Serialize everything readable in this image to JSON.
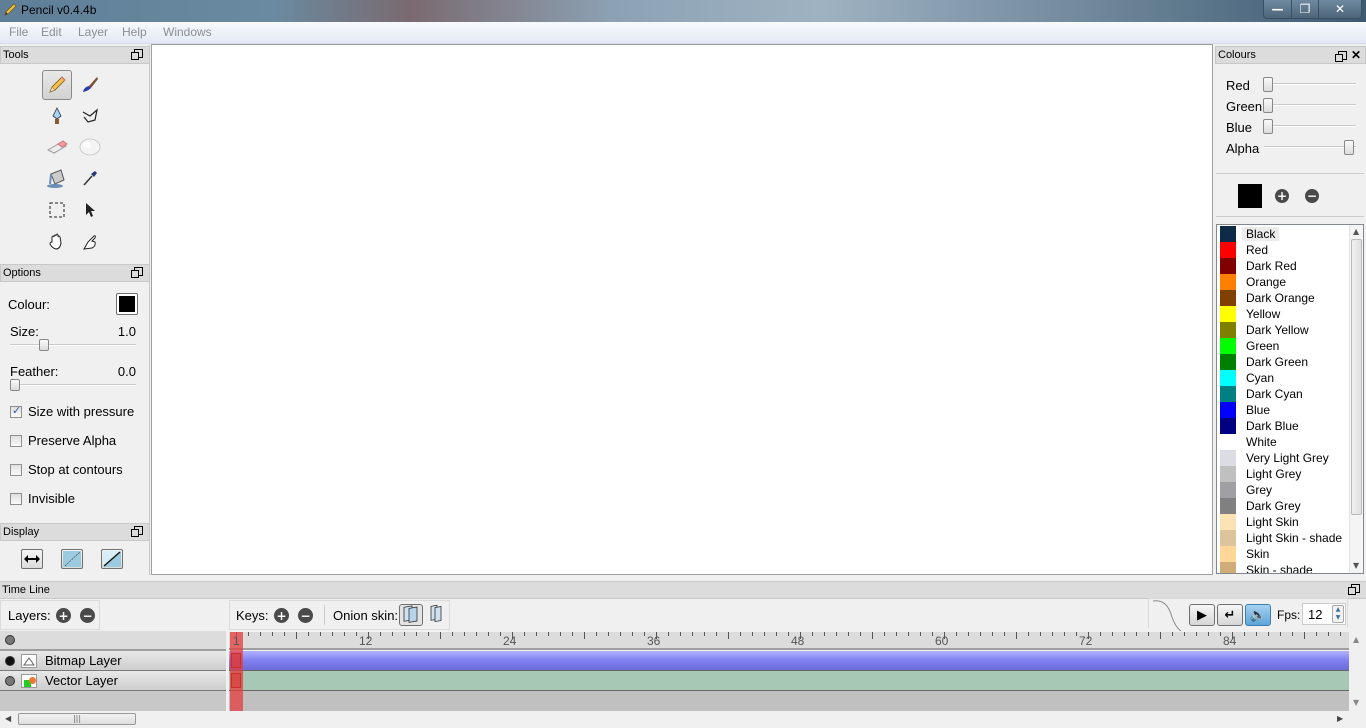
{
  "window": {
    "title": "Pencil v0.4.4b",
    "minimize": "—",
    "maximize": "❐",
    "close": "✕"
  },
  "menu": [
    "File",
    "Edit",
    "Layer",
    "Help",
    "Windows"
  ],
  "tools_panel": {
    "title": "Tools",
    "tools": [
      {
        "name": "pencil",
        "active": true
      },
      {
        "name": "brush",
        "active": false
      },
      {
        "name": "pen",
        "active": false
      },
      {
        "name": "polyline",
        "active": false
      },
      {
        "name": "eraser",
        "active": false
      },
      {
        "name": "smudge",
        "active": false
      },
      {
        "name": "bucket",
        "active": false
      },
      {
        "name": "eyedropper",
        "active": false
      },
      {
        "name": "select",
        "active": false
      },
      {
        "name": "move",
        "active": false
      },
      {
        "name": "hand",
        "active": false
      },
      {
        "name": "clear",
        "active": false
      }
    ]
  },
  "options_panel": {
    "title": "Options",
    "colour_label": "Colour:",
    "colour_value": "#000000",
    "size_label": "Size:",
    "size_value": "1.0",
    "size_fraction": 0.25,
    "feather_label": "Feather:",
    "feather_value": "0.0",
    "feather_fraction": 0.0,
    "checkboxes": [
      {
        "label": "Size with pressure",
        "checked": true
      },
      {
        "label": "Preserve Alpha",
        "checked": false
      },
      {
        "label": "Stop at contours",
        "checked": false
      },
      {
        "label": "Invisible",
        "checked": false
      }
    ]
  },
  "display_panel": {
    "title": "Display",
    "buttons": [
      "mirror",
      "thin-lines",
      "outlines"
    ]
  },
  "colours_panel": {
    "title": "Colours",
    "sliders": [
      {
        "label": "Red",
        "fraction": 0.0
      },
      {
        "label": "Green",
        "fraction": 0.0
      },
      {
        "label": "Blue",
        "fraction": 0.0
      },
      {
        "label": "Alpha",
        "fraction": 1.0
      }
    ],
    "current_colour": "#000000",
    "palette": [
      {
        "name": "Black",
        "color": "#0e2a48",
        "selected": true
      },
      {
        "name": "Red",
        "color": "#ff0000"
      },
      {
        "name": "Dark Red",
        "color": "#800000"
      },
      {
        "name": "Orange",
        "color": "#ff8000"
      },
      {
        "name": "Dark Orange",
        "color": "#804000"
      },
      {
        "name": "Yellow",
        "color": "#ffff00"
      },
      {
        "name": "Dark Yellow",
        "color": "#808000"
      },
      {
        "name": "Green",
        "color": "#00ff00"
      },
      {
        "name": "Dark Green",
        "color": "#008000"
      },
      {
        "name": "Cyan",
        "color": "#00ffff"
      },
      {
        "name": "Dark Cyan",
        "color": "#008080"
      },
      {
        "name": "Blue",
        "color": "#0000ff"
      },
      {
        "name": "Dark Blue",
        "color": "#000080"
      },
      {
        "name": "White",
        "color": "#ffffff"
      },
      {
        "name": "Very Light Grey",
        "color": "#dcdce4"
      },
      {
        "name": "Light Grey",
        "color": "#c0c0c0"
      },
      {
        "name": "Grey",
        "color": "#a0a0a4"
      },
      {
        "name": "Dark Grey",
        "color": "#808080"
      },
      {
        "name": "Light Skin",
        "color": "#fce3b4"
      },
      {
        "name": "Light Skin - shade",
        "color": "#dcc49c"
      },
      {
        "name": "Skin",
        "color": "#ffd796"
      },
      {
        "name": "Skin - shade",
        "color": "#d0ac78"
      }
    ]
  },
  "timeline": {
    "title": "Time Line",
    "layers_label": "Layers:",
    "keys_label": "Keys:",
    "onion_label": "Onion skin:",
    "fps_label": "Fps:",
    "fps_value": "12",
    "current_frame": 1,
    "ruler_labels": [
      "1",
      "12",
      "24",
      "36",
      "48",
      "60",
      "72",
      "84"
    ],
    "layers": [
      {
        "name": "Bitmap Layer",
        "type": "bitmap",
        "visible": true,
        "track_color": "#7f7ff0"
      },
      {
        "name": "Vector Layer",
        "type": "vector",
        "visible": false,
        "track_color": "#a6c8b4"
      }
    ]
  }
}
